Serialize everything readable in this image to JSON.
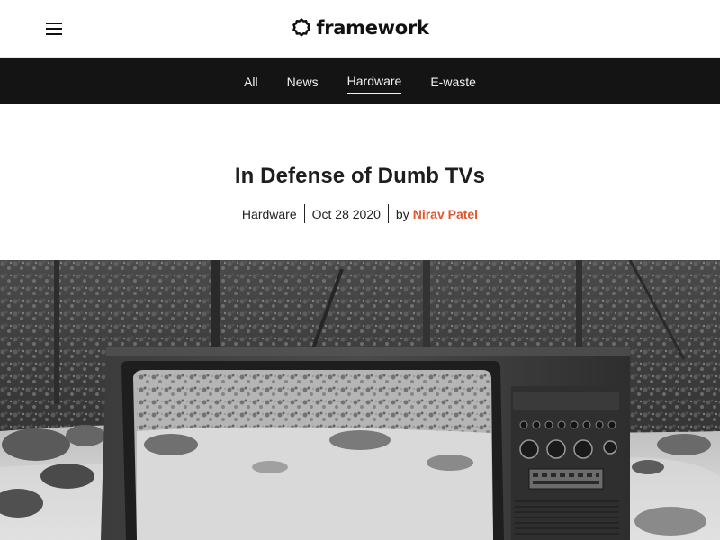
{
  "brand": {
    "name": "framework"
  },
  "nav": {
    "items": [
      {
        "label": "All"
      },
      {
        "label": "News"
      },
      {
        "label": "Hardware",
        "active": true
      },
      {
        "label": "E-waste"
      }
    ]
  },
  "article": {
    "title": "In Defense of Dumb TVs",
    "category": "Hardware",
    "date": "Oct 28 2020",
    "by_label": "by",
    "author": "Nirav Patel"
  },
  "colors": {
    "accent": "#e0562e",
    "nav_bg": "#141414"
  },
  "icons": {
    "menu": "hamburger-menu-icon",
    "logo": "framework-gear-logo-icon"
  }
}
